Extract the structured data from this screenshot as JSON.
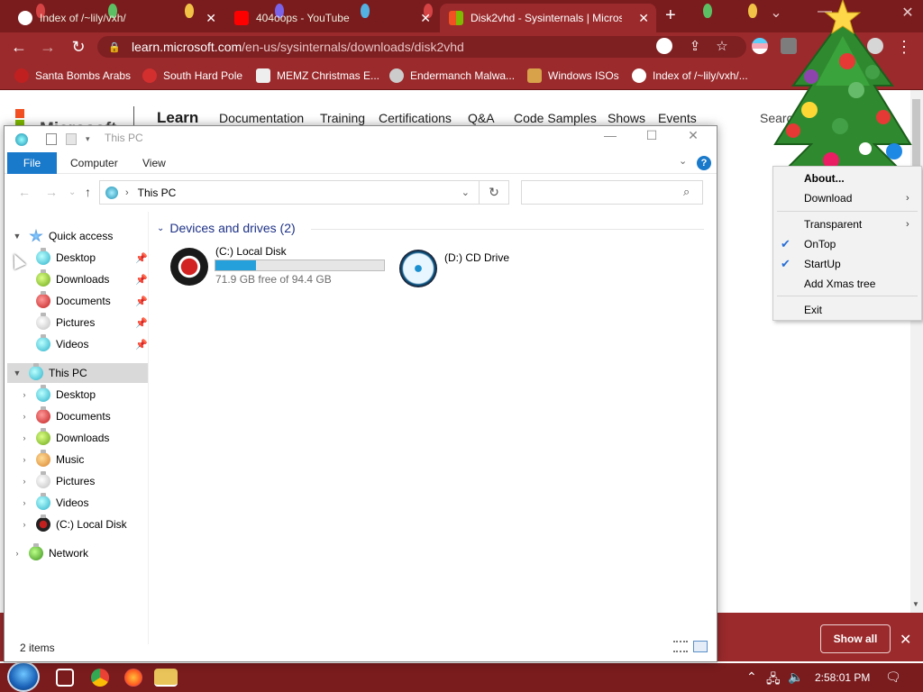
{
  "browser": {
    "tabs": [
      {
        "label": "Index of /~lily/vxh/",
        "active": false
      },
      {
        "label": "404oops - YouTube",
        "active": false
      },
      {
        "label": "Disk2vhd - Sysinternals | Microso",
        "active": true
      }
    ],
    "url_host": "learn.microsoft.com",
    "url_path": "/en-us/sysinternals/downloads/disk2vhd",
    "bookmarks": [
      "Santa Bombs Arabs",
      "South Hard Pole",
      "MEMZ Christmas E...",
      "Endermanch Malwa...",
      "Windows ISOs",
      "Index of /~lily/vxh/..."
    ],
    "theme_color": "#9b2a2c"
  },
  "website": {
    "brand": "Microsoft",
    "product": "Learn",
    "nav": [
      "Documentation",
      "Training",
      "Certifications",
      "Q&A",
      "Code Samples",
      "Shows",
      "Events"
    ],
    "search": "Search"
  },
  "explorer": {
    "title": "This PC",
    "ribbon_tabs": {
      "file": "File",
      "computer": "Computer",
      "view": "View"
    },
    "help": "?",
    "address": "This PC",
    "search_placeholder": "",
    "quick_access": {
      "label": "Quick access",
      "items": [
        "Desktop",
        "Downloads",
        "Documents",
        "Pictures",
        "Videos"
      ]
    },
    "this_pc": {
      "label": "This PC",
      "items": [
        "Desktop",
        "Documents",
        "Downloads",
        "Music",
        "Pictures",
        "Videos",
        "(C:) Local Disk"
      ]
    },
    "network": "Network",
    "group_header": "Devices and drives (2)",
    "drives": [
      {
        "name": "(C:) Local Disk",
        "free_text": "71.9 GB free of 94.4 GB",
        "used_fraction": 0.238
      },
      {
        "name": "(D:) CD Drive"
      }
    ],
    "status": "2 items",
    "accent": "#1979ca"
  },
  "context_menu": {
    "items": [
      {
        "label": "About...",
        "bold": true
      },
      {
        "label": "Download",
        "submenu": true
      },
      {
        "label": "Transparent",
        "submenu": true
      },
      {
        "label": "OnTop",
        "checked": true
      },
      {
        "label": "StartUp",
        "checked": true
      },
      {
        "label": "Add Xmas tree"
      },
      {
        "label": "Exit"
      }
    ]
  },
  "notification": {
    "show_all": "Show all"
  },
  "taskbar": {
    "clock": "2:58:01 PM"
  }
}
